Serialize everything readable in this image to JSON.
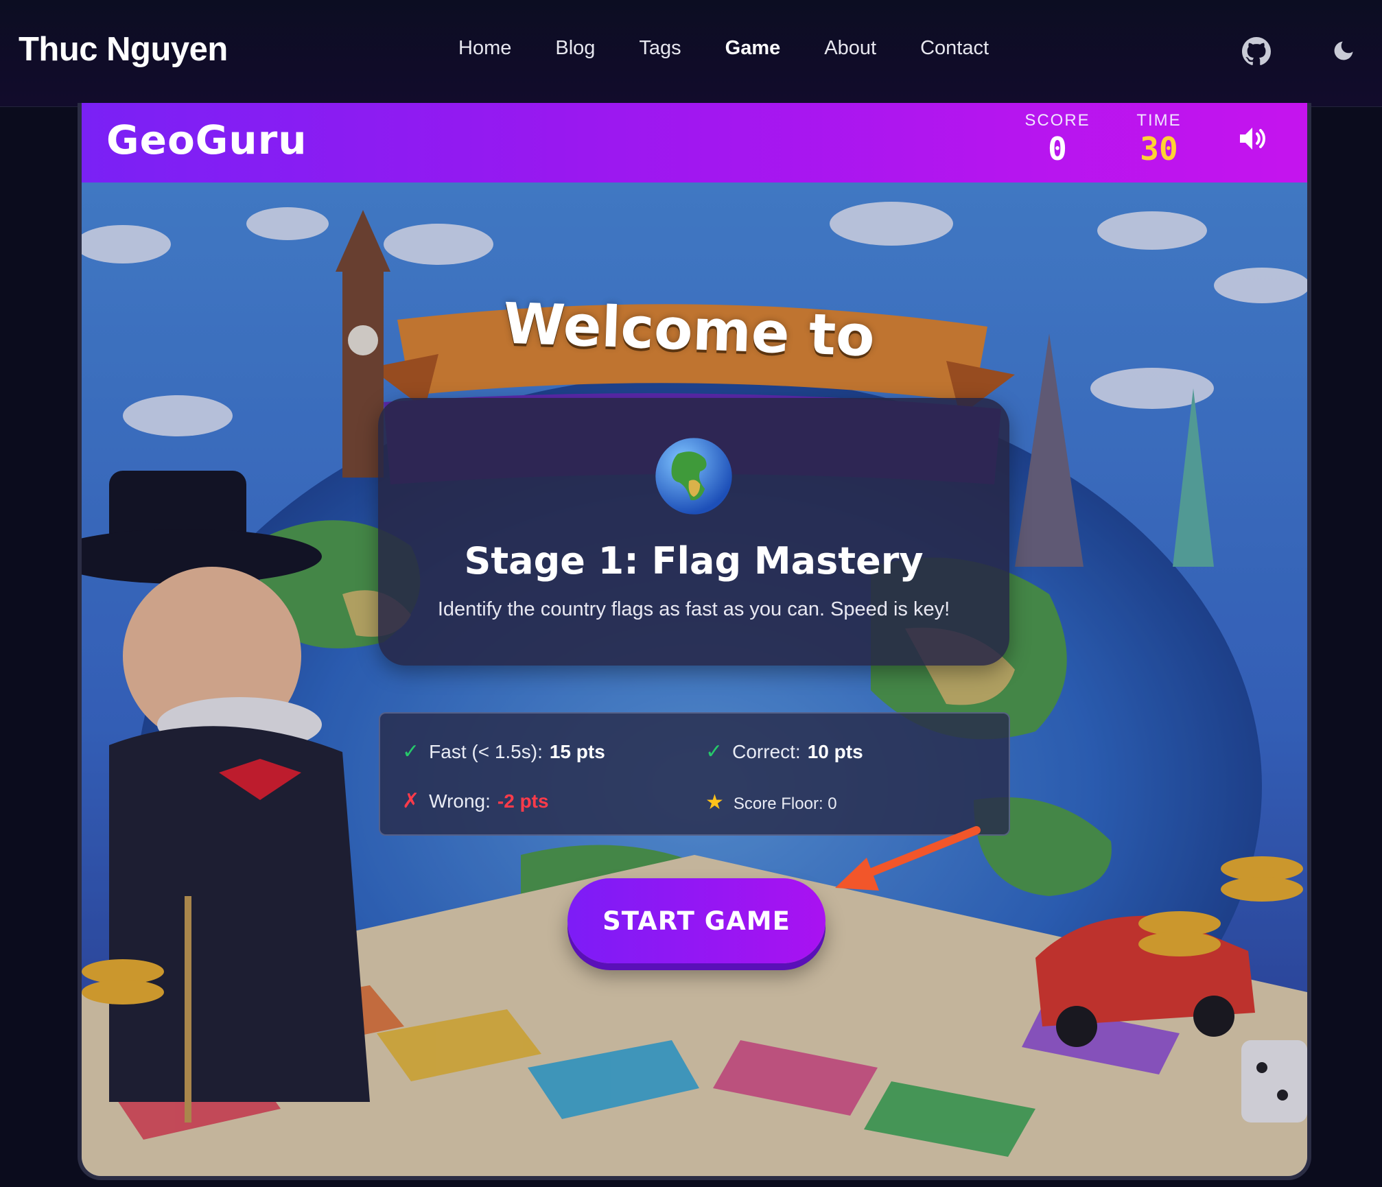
{
  "site": {
    "brand": "Thuc Nguyen",
    "nav": [
      "Home",
      "Blog",
      "Tags",
      "Game",
      "About",
      "Contact"
    ],
    "active_nav": "Game",
    "icons": [
      "github-icon",
      "moon-icon"
    ]
  },
  "game": {
    "logo": "GeoGuru",
    "score_label": "SCORE",
    "score_value": "0",
    "time_label": "TIME",
    "time_value": "30",
    "accent_color": "#9918f0",
    "time_color": "#ffd233",
    "welcome": "Welcome to",
    "stage_title": "Stage 1: Flag Mastery",
    "stage_desc": "Identify the country flags as fast as you can. Speed is key!",
    "rules": {
      "fast_label": "Fast (< 1.5s):",
      "fast_pts": "15 pts",
      "correct_label": "Correct:",
      "correct_pts": "10 pts",
      "wrong_label": "Wrong:",
      "wrong_pts": "-2 pts",
      "floor": "Score Floor: 0"
    },
    "start_label": "START GAME"
  }
}
